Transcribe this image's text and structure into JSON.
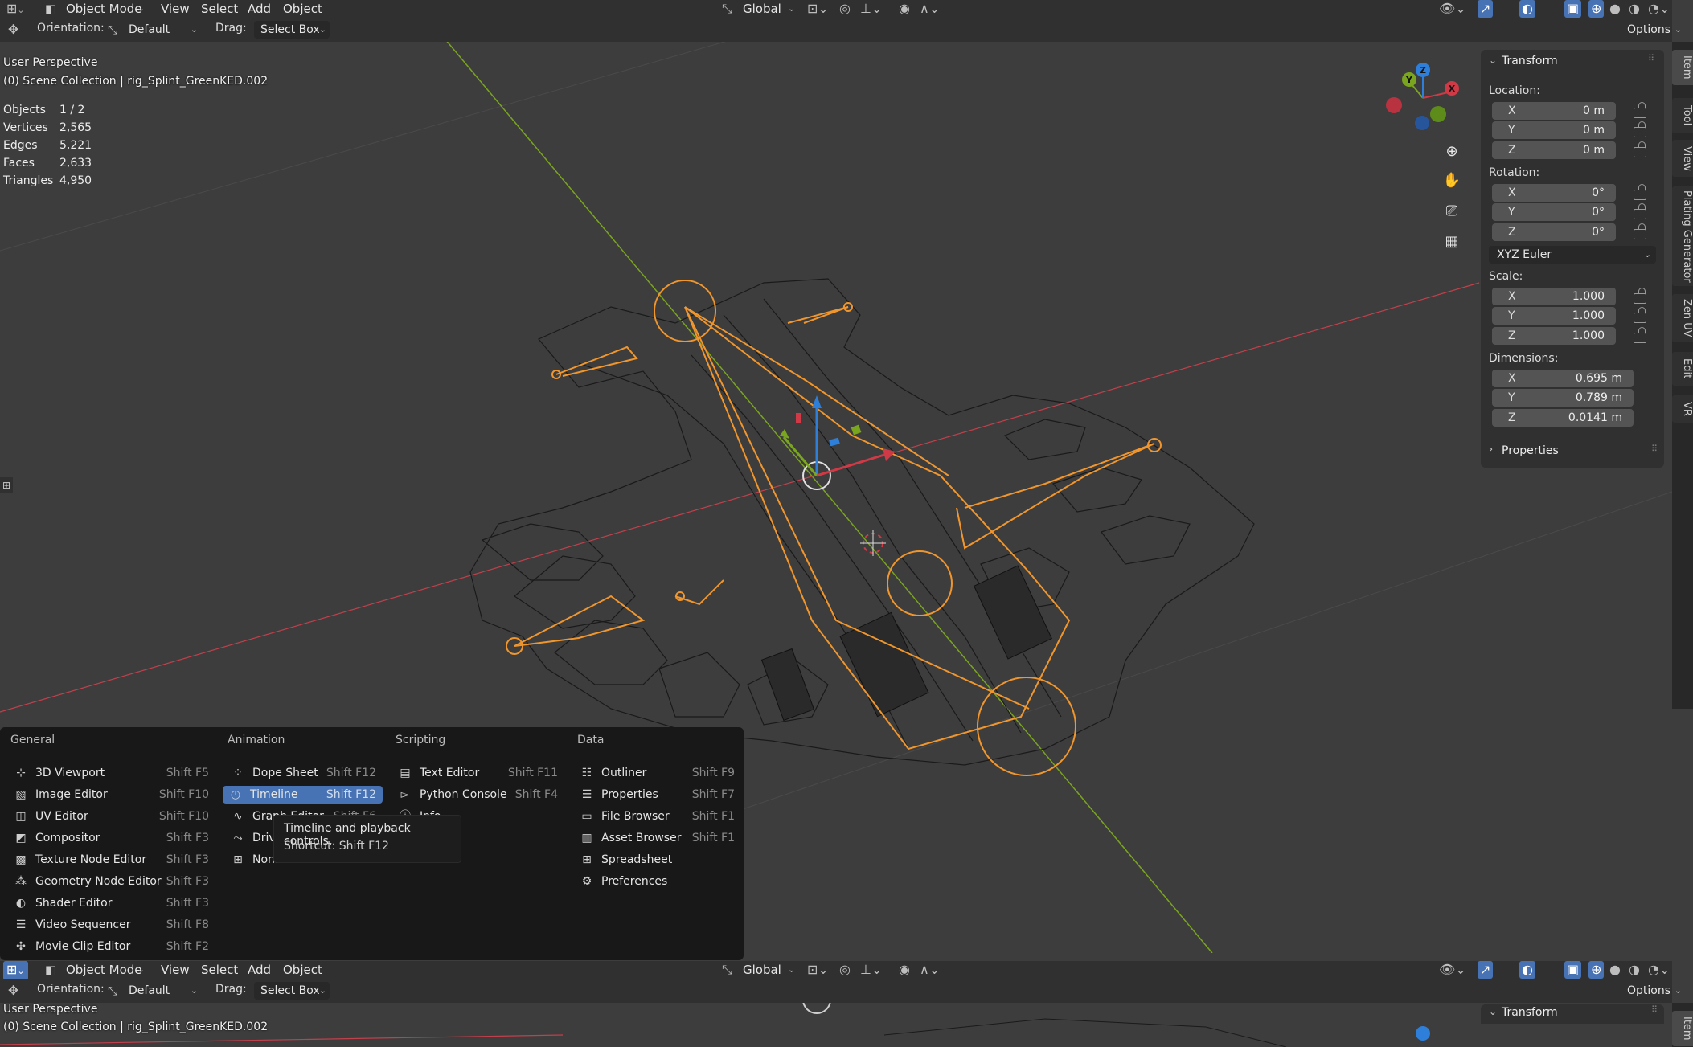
{
  "header": {
    "mode": "Object Mode",
    "menus": [
      "View",
      "Select",
      "Add",
      "Object"
    ],
    "transform_orientation": "Global",
    "options_label": "Options"
  },
  "toolbar": {
    "orientation_label": "Orientation:",
    "orientation_value": "Default",
    "drag_label": "Drag:",
    "drag_value": "Select Box"
  },
  "viewport": {
    "view_name": "User Perspective",
    "collection": "(0) Scene Collection | rig_Splint_GreenKED.002",
    "stats": [
      {
        "label": "Objects",
        "value": "1 / 2"
      },
      {
        "label": "Vertices",
        "value": "2,565"
      },
      {
        "label": "Edges",
        "value": "5,221"
      },
      {
        "label": "Faces",
        "value": "2,633"
      },
      {
        "label": "Triangles",
        "value": "4,950"
      }
    ],
    "gizmo_axes": [
      "X",
      "Y",
      "Z"
    ]
  },
  "npanel": {
    "transform_title": "Transform",
    "location_label": "Location:",
    "location": [
      {
        "axis": "X",
        "value": "0 m"
      },
      {
        "axis": "Y",
        "value": "0 m"
      },
      {
        "axis": "Z",
        "value": "0 m"
      }
    ],
    "rotation_label": "Rotation:",
    "rotation": [
      {
        "axis": "X",
        "value": "0°"
      },
      {
        "axis": "Y",
        "value": "0°"
      },
      {
        "axis": "Z",
        "value": "0°"
      }
    ],
    "rotation_mode": "XYZ Euler",
    "scale_label": "Scale:",
    "scale": [
      {
        "axis": "X",
        "value": "1.000"
      },
      {
        "axis": "Y",
        "value": "1.000"
      },
      {
        "axis": "Z",
        "value": "1.000"
      }
    ],
    "dimensions_label": "Dimensions:",
    "dimensions": [
      {
        "axis": "X",
        "value": "0.695 m"
      },
      {
        "axis": "Y",
        "value": "0.789 m"
      },
      {
        "axis": "Z",
        "value": "0.0141 m"
      }
    ],
    "properties_title": "Properties",
    "tabs": [
      "Item",
      "Tool",
      "View",
      "Plating Generator",
      "Zen UV",
      "Edit",
      "VR"
    ]
  },
  "editor_menu": {
    "columns": [
      {
        "heading": "General",
        "items": [
          {
            "label": "3D Viewport",
            "shortcut": "Shift F5",
            "icon": "viewport-icon"
          },
          {
            "label": "Image Editor",
            "shortcut": "Shift F10",
            "icon": "image-icon"
          },
          {
            "label": "UV Editor",
            "shortcut": "Shift F10",
            "icon": "uv-icon"
          },
          {
            "label": "Compositor",
            "shortcut": "Shift F3",
            "icon": "compositor-icon"
          },
          {
            "label": "Texture Node Editor",
            "shortcut": "Shift F3",
            "icon": "texture-icon"
          },
          {
            "label": "Geometry Node Editor",
            "shortcut": "Shift F3",
            "icon": "geometry-icon"
          },
          {
            "label": "Shader Editor",
            "shortcut": "Shift F3",
            "icon": "shader-icon"
          },
          {
            "label": "Video Sequencer",
            "shortcut": "Shift F8",
            "icon": "sequencer-icon"
          },
          {
            "label": "Movie Clip Editor",
            "shortcut": "Shift F2",
            "icon": "clip-icon"
          }
        ]
      },
      {
        "heading": "Animation",
        "items": [
          {
            "label": "Dope Sheet",
            "shortcut": "Shift F12",
            "icon": "dopesheet-icon"
          },
          {
            "label": "Timeline",
            "shortcut": "Shift F12",
            "icon": "timeline-icon"
          },
          {
            "label": "Graph Editor",
            "shortcut": "Shift F6",
            "icon": "graph-icon"
          },
          {
            "label": "Drivers",
            "shortcut": "",
            "icon": "drivers-icon"
          },
          {
            "label": "Nonlinear Animation",
            "shortcut": "",
            "icon": "nla-icon"
          }
        ]
      },
      {
        "heading": "Scripting",
        "items": [
          {
            "label": "Text Editor",
            "shortcut": "Shift F11",
            "icon": "text-icon"
          },
          {
            "label": "Python Console",
            "shortcut": "Shift F4",
            "icon": "console-icon"
          },
          {
            "label": "Info",
            "shortcut": "",
            "icon": "info-icon"
          }
        ]
      },
      {
        "heading": "Data",
        "items": [
          {
            "label": "Outliner",
            "shortcut": "Shift F9",
            "icon": "outliner-icon"
          },
          {
            "label": "Properties",
            "shortcut": "Shift F7",
            "icon": "properties-icon"
          },
          {
            "label": "File Browser",
            "shortcut": "Shift F1",
            "icon": "filebrowser-icon"
          },
          {
            "label": "Asset Browser",
            "shortcut": "Shift F1",
            "icon": "asset-icon"
          },
          {
            "label": "Spreadsheet",
            "shortcut": "",
            "icon": "spreadsheet-icon"
          },
          {
            "label": "Preferences",
            "shortcut": "",
            "icon": "preferences-icon"
          }
        ]
      }
    ],
    "tooltip_line1": "Timeline and playback controls.",
    "tooltip_line2": "Shortcut: Shift F12"
  },
  "colors": {
    "accent": "#4772b3",
    "selection_orange": "#f0962d",
    "x_axis": "#d03a47",
    "y_axis": "#7aa51e",
    "z_axis": "#2e7fd9"
  }
}
